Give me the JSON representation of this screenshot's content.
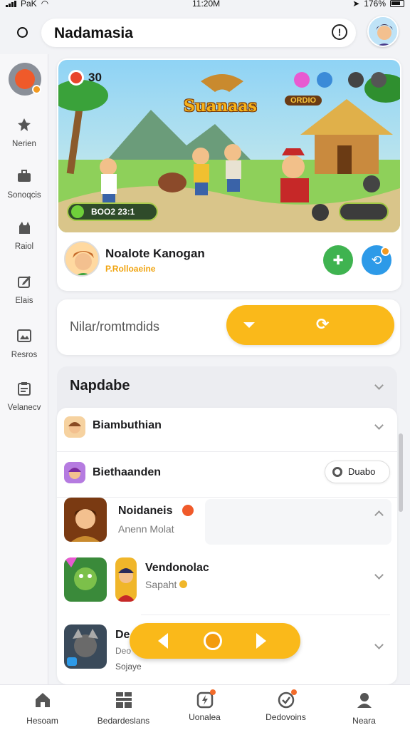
{
  "status": {
    "carrier": "PaK",
    "time": "11:20M",
    "battery": "176%"
  },
  "topbar": {
    "search_text": "Nadamasia"
  },
  "sidebar": {
    "items": [
      {
        "label": "Nerien",
        "icon": "figure-icon"
      },
      {
        "label": "Sonoqcis",
        "icon": "briefcase-icon"
      },
      {
        "label": "Raiol",
        "icon": "cat-icon"
      },
      {
        "label": "Elais",
        "icon": "edit-icon"
      },
      {
        "label": "Resros",
        "icon": "image-icon"
      },
      {
        "label": "Velanecv",
        "icon": "clipboard-icon"
      }
    ]
  },
  "hero": {
    "banner": {
      "score": "30",
      "title": "Suanaas",
      "gold_label": "ORDIO",
      "coin_label": "BOO2 23:1"
    },
    "name": "Noalote Kanogan",
    "subtitle": "P.Rolloaeine"
  },
  "input_card": {
    "placeholder": "Nilar/romtmdids"
  },
  "list": {
    "header": "Napdabe",
    "rows": [
      {
        "name": "Biambuthian"
      },
      {
        "name": "Biethaanden",
        "pill_label": "Duabo"
      }
    ],
    "big_items": [
      {
        "name": "Noidaneis",
        "sub": "Anenn Molat"
      },
      {
        "name": "Vendonolac",
        "sub": "Sapaht"
      },
      {
        "name": "De",
        "sub": "Deo",
        "sub2": "Sojaye"
      }
    ]
  },
  "bottom_nav": [
    {
      "label": "Hesoam",
      "icon": "home-icon"
    },
    {
      "label": "Bedardeslans",
      "icon": "grid-icon"
    },
    {
      "label": "Uonalea",
      "icon": "bolt-badge-icon"
    },
    {
      "label": "Dedovoins",
      "icon": "check-circle-icon"
    },
    {
      "label": "Neara",
      "icon": "person-icon"
    }
  ],
  "colors": {
    "accent": "#fab91a",
    "green": "#3fb350",
    "blue": "#2d9ae8",
    "badge": "#f26b2a"
  }
}
